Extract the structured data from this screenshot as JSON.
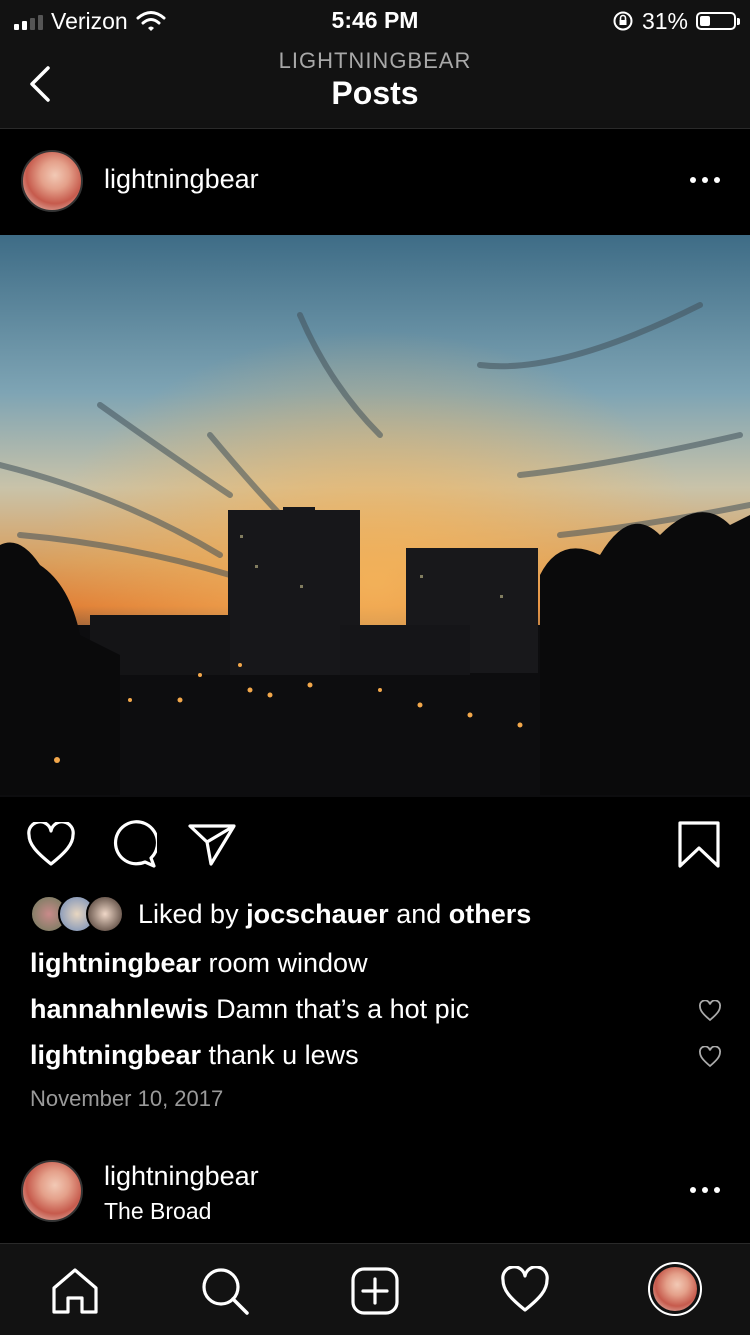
{
  "status_bar": {
    "carrier": "Verizon",
    "time": "5:46 PM",
    "battery_percent": "31%",
    "battery_level": 0.31,
    "signal_bars": 2
  },
  "header": {
    "account": "LIGHTNINGBEAR",
    "title": "Posts"
  },
  "post": {
    "username": "lightningbear",
    "liked_prefix": "Liked by",
    "liked_user": "jocschauer",
    "liked_and": "and",
    "liked_others": "others",
    "caption_user": "lightningbear",
    "caption_text": "room window",
    "comments": [
      {
        "user": "hannahnlewis",
        "text": "Damn that’s a hot pic"
      },
      {
        "user": "lightningbear",
        "text": "thank u lews"
      }
    ],
    "date": "November 10, 2017"
  },
  "next_post": {
    "username": "lightningbear",
    "location": "The Broad"
  },
  "icons": {
    "back": "chevron-left-icon",
    "more": "more-horizontal-icon",
    "like": "heart-icon",
    "comment": "comment-bubble-icon",
    "share": "paper-plane-icon",
    "save": "bookmark-icon"
  },
  "tab_bar": [
    "home-icon",
    "search-icon",
    "new-post-icon",
    "activity-heart-icon",
    "profile-avatar"
  ],
  "colors": {
    "background": "#000000",
    "bar_background": "#121212",
    "secondary_text": "#9a9a9a"
  }
}
